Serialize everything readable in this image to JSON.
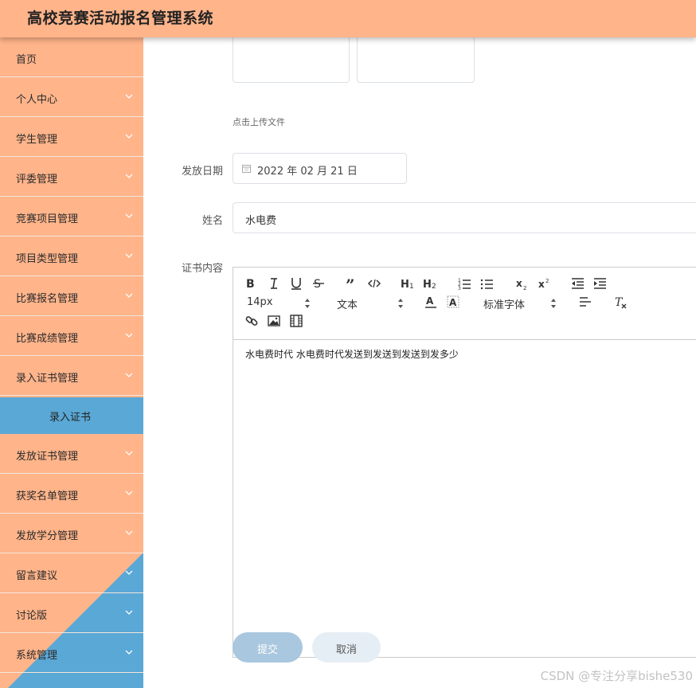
{
  "app": {
    "title": "高校竞赛活动报名管理系统"
  },
  "sidebar": {
    "items": [
      {
        "label": "首页",
        "has_children": false
      },
      {
        "label": "个人中心",
        "has_children": true
      },
      {
        "label": "学生管理",
        "has_children": true
      },
      {
        "label": "评委管理",
        "has_children": true
      },
      {
        "label": "竞赛项目管理",
        "has_children": true
      },
      {
        "label": "项目类型管理",
        "has_children": true
      },
      {
        "label": "比赛报名管理",
        "has_children": true
      },
      {
        "label": "比赛成绩管理",
        "has_children": true
      },
      {
        "label": "录入证书管理",
        "has_children": true,
        "expanded": true
      },
      {
        "label": "录入证书",
        "submenu": true,
        "active": true
      },
      {
        "label": "发放证书管理",
        "has_children": true
      },
      {
        "label": "获奖名单管理",
        "has_children": true
      },
      {
        "label": "发放学分管理",
        "has_children": true
      },
      {
        "label": "留言建议",
        "has_children": true
      },
      {
        "label": "讨论版",
        "has_children": true
      },
      {
        "label": "系统管理",
        "has_children": true
      }
    ],
    "colors": {
      "base": "#ffb48a",
      "accent": "#5aa8d5"
    }
  },
  "form": {
    "upload_hint": "点击上传文件",
    "date": {
      "label": "发放日期",
      "value": "2022 年 02 月 21 日",
      "icon": "calendar-icon"
    },
    "name": {
      "label": "姓名",
      "value": "水电费"
    },
    "content": {
      "label": "证书内容",
      "toolbar": {
        "font_size": "14px",
        "text_type": "文本",
        "font_family": "标准字体",
        "buttons": [
          "bold-icon",
          "italic-icon",
          "underline-icon",
          "strikethrough-icon",
          "blockquote-icon",
          "code-icon",
          "h1-icon",
          "h2-icon",
          "ordered-list-icon",
          "bullet-list-icon",
          "subscript-icon",
          "superscript-icon",
          "indent-decrease-icon",
          "indent-increase-icon",
          "font-color-icon",
          "background-color-icon",
          "align-icon",
          "clear-format-icon",
          "link-icon",
          "image-icon",
          "video-icon"
        ]
      },
      "text": "水电费时代 水电费时代发送到发送到发送到发多少"
    },
    "submit_label": "提交",
    "cancel_label": "取消"
  },
  "watermark": "CSDN @专注分享bishe530"
}
